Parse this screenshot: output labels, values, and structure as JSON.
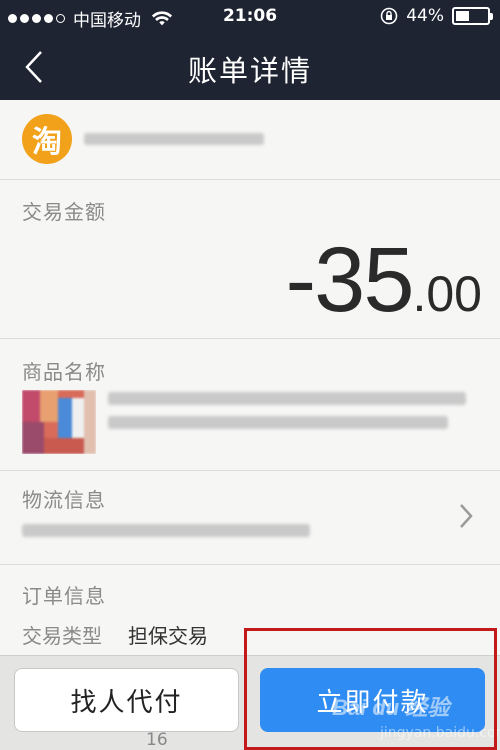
{
  "status_bar": {
    "carrier": "中国移动",
    "time": "21:06",
    "battery": "44%",
    "battery_level": 0.44,
    "signal_filled": 4,
    "signal_total": 5
  },
  "nav": {
    "title": "账单详情",
    "back_icon": "chevron-left-icon"
  },
  "merchant": {
    "logo_text": "淘"
  },
  "amount_section": {
    "label": "交易金额",
    "amount_integer": "-35",
    "amount_decimal": ".00"
  },
  "product_section": {
    "label": "商品名称"
  },
  "logistics_section": {
    "label": "物流信息",
    "chevron_icon": "chevron-right-icon"
  },
  "order_section": {
    "label": "订单信息",
    "type_key": "交易类型",
    "type_value": "担保交易"
  },
  "actions": {
    "peer_pay_label": "找人代付",
    "pay_now_label": "立即付款"
  },
  "colors": {
    "nav_bg": "#1f2433",
    "pay_button": "#2f8cf2",
    "highlight": "#c21a1a",
    "taobao_orange": "#f2a11a"
  },
  "footer_peek": "16",
  "watermark": {
    "brand": "Bai du 经验",
    "site": "jingyan.baidu.com"
  }
}
